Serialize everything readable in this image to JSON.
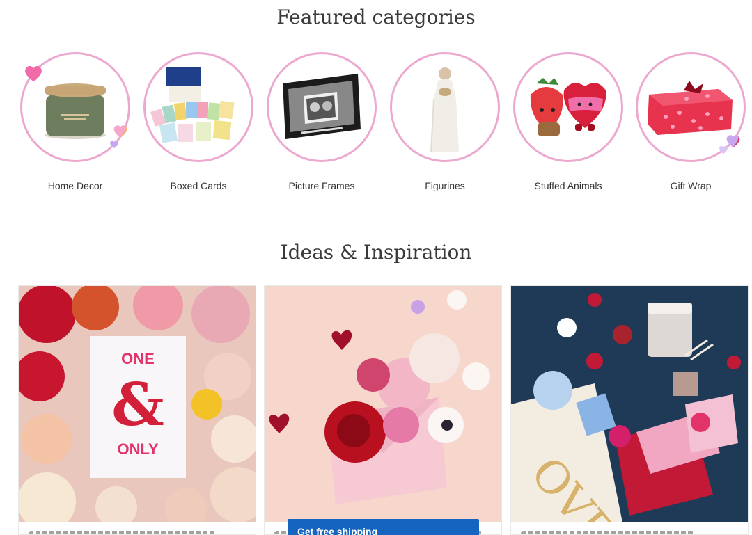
{
  "featured": {
    "title": "Featured categories",
    "items": [
      {
        "label": "Home Decor",
        "icon": "candle-image"
      },
      {
        "label": "Boxed Cards",
        "icon": "boxed-cards-image"
      },
      {
        "label": "Picture Frames",
        "icon": "picture-frame-image"
      },
      {
        "label": "Figurines",
        "icon": "figurine-image"
      },
      {
        "label": "Stuffed Animals",
        "icon": "stuffed-animals-image"
      },
      {
        "label": "Gift Wrap",
        "icon": "gift-wrap-image"
      }
    ]
  },
  "ideas": {
    "title": "Ideas & Inspiration",
    "cards": [
      {
        "image": "one-and-only-card-flowers",
        "card_text_top": "ONE",
        "card_text_amp": "&",
        "card_text_bottom": "ONLY"
      },
      {
        "image": "envelope-with-roses"
      },
      {
        "image": "love-gift-bag-flatlay",
        "bag_text": "OVE"
      }
    ]
  },
  "promo": {
    "shipping_label": "Get free shipping"
  },
  "colors": {
    "ring": "#eca8cf",
    "accent": "#1565c0",
    "heart": "#f06ba8"
  }
}
